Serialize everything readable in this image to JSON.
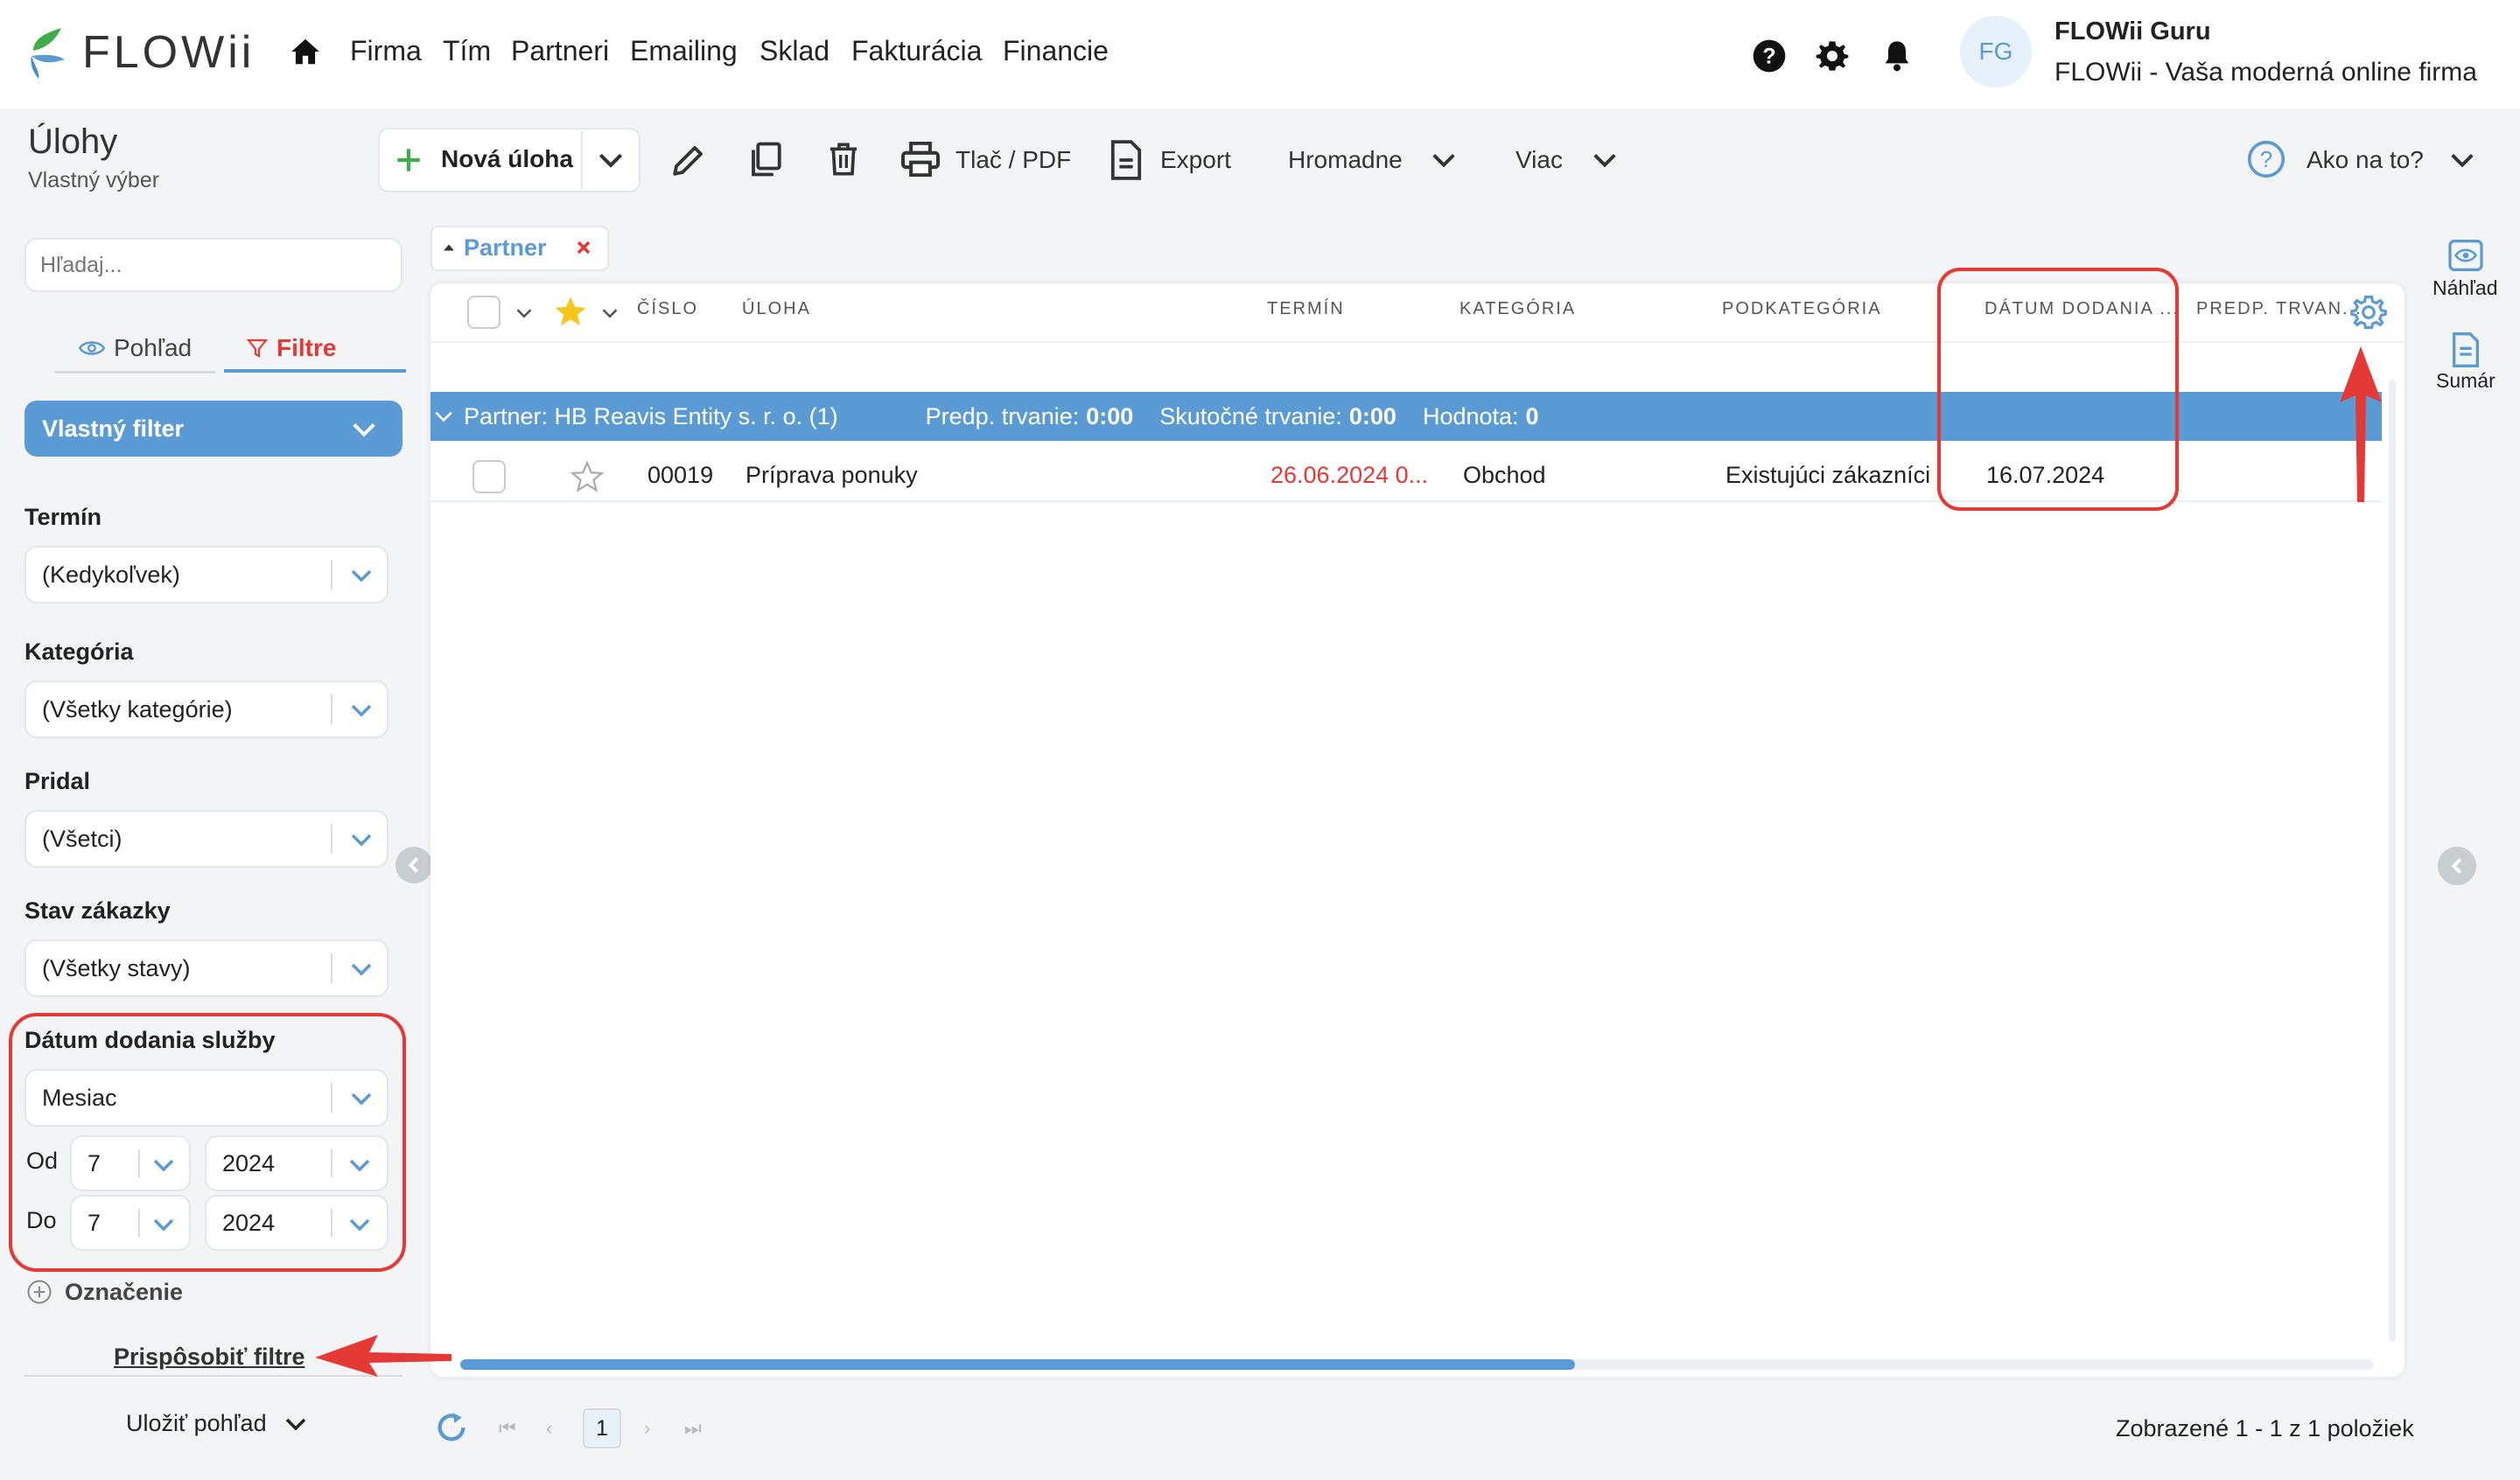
{
  "app": {
    "logo_text": "FLOWii"
  },
  "nav": {
    "items": [
      "Firma",
      "Tím",
      "Partneri",
      "Emailing",
      "Sklad",
      "Fakturácia",
      "Financie"
    ]
  },
  "user": {
    "initials": "FG",
    "name": "FLOWii Guru",
    "company": "FLOWii - Vaša moderná online firma"
  },
  "page": {
    "title": "Úlohy",
    "subtitle": "Vlastný výber"
  },
  "toolbar": {
    "new_task": "Nová úloha",
    "print": "Tlač / PDF",
    "export": "Export",
    "bulk": "Hromadne",
    "more": "Viac",
    "help": "Ako na to?"
  },
  "sidebar": {
    "search_placeholder": "Hľadaj...",
    "tab_view": "Pohľad",
    "tab_filters": "Filtre",
    "custom_filter": "Vlastný filter",
    "filters": {
      "term_label": "Termín",
      "term_value": "(Kedykoľvek)",
      "category_label": "Kategória",
      "category_value": "(Všetky kategórie)",
      "added_label": "Pridal",
      "added_value": "(Všetci)",
      "status_label": "Stav zákazky",
      "status_value": "(Všetky stavy)",
      "delivery_label": "Dátum dodania služby",
      "delivery_period": "Mesiac",
      "from_label": "Od",
      "from_month": "7",
      "from_year": "2024",
      "to_label": "Do",
      "to_month": "7",
      "to_year": "2024",
      "tag_label": "Označenie"
    },
    "customize_link": "Prispôsobiť filtre",
    "save_view": "Uložiť pohľad"
  },
  "right_panel": {
    "preview": "Náhľad",
    "summary": "Sumár"
  },
  "grid": {
    "group_chip": "Partner",
    "columns": [
      "ČÍSLO",
      "ÚLOHA",
      "TERMÍN",
      "KATEGÓRIA",
      "PODKATEGÓRIA",
      "DÁTUM DODANIA ...",
      "PREDP. TRVAN..."
    ],
    "group": {
      "label": "Partner: HB Reavis Entity s. r. o. (1)",
      "est_label": "Predp. trvanie:",
      "est_value": "0:00",
      "actual_label": "Skutočné trvanie:",
      "actual_value": "0:00",
      "value_label": "Hodnota:",
      "value_value": "0"
    },
    "rows": [
      {
        "number": "00019",
        "task": "Príprava ponuky",
        "term": "26.06.2024 0...",
        "category": "Obchod",
        "subcategory": "Existujúci zákazníci",
        "delivery": "16.07.2024"
      }
    ]
  },
  "pager": {
    "page": "1",
    "summary": "Zobrazené 1 - 1 z 1 položiek"
  },
  "colors": {
    "accent": "#5b9bd5",
    "red": "#e53935",
    "green": "#3fae49",
    "overdue": "#e53935"
  }
}
